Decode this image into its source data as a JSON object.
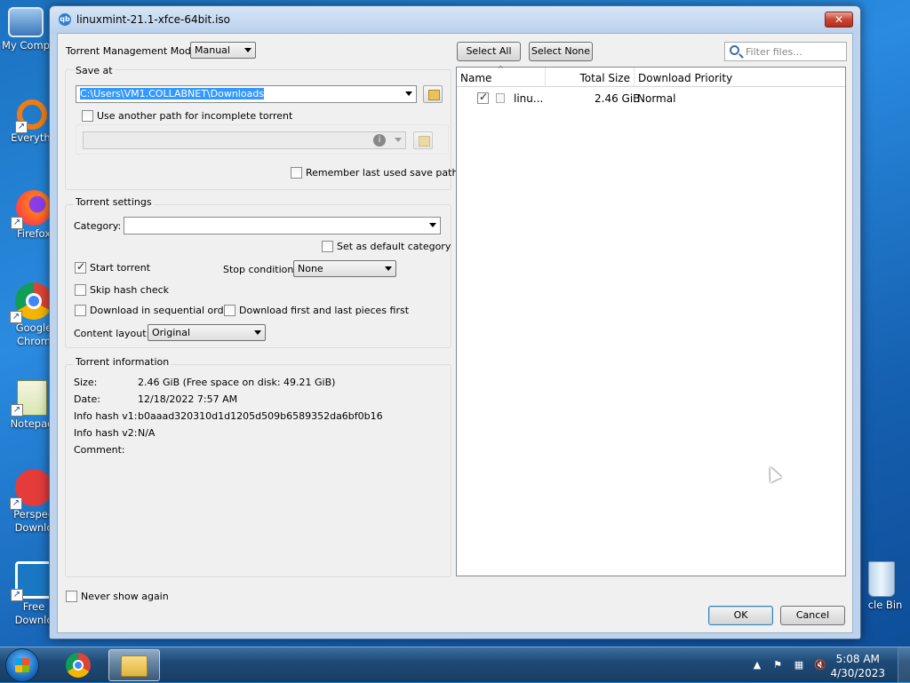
{
  "desktop": {
    "icons": [
      {
        "label": "My Comp",
        "glyph": "🖥"
      },
      {
        "label": "Everythi",
        "glyph": "○"
      },
      {
        "label": "Firefox",
        "glyph": "🦊"
      },
      {
        "label": "Google Chrom",
        "glyph": "◉"
      },
      {
        "label": "Notepad",
        "glyph": "📝"
      },
      {
        "label": "Perspeo Downlo",
        "glyph": "⚡"
      },
      {
        "label": "Free Downlo",
        "glyph": "⇩"
      },
      {
        "label": "cle Bin",
        "glyph": "🗑"
      }
    ]
  },
  "dialog": {
    "title": "linuxmint-21.1-xfce-64bit.iso",
    "close_glyph": "✕",
    "mgmt_mode_label": "Torrent Management Mode:",
    "mgmt_mode_value": "Manual",
    "save_at_title": "Save at",
    "save_path": "C:\\Users\\VM1.COLLABNET\\Downloads",
    "use_another_path_label": "Use another path for incomplete torrent",
    "remember_path_label": "Remember last used save path",
    "torrent_settings_title": "Torrent settings",
    "category_label": "Category:",
    "category_value": "",
    "set_default_category_label": "Set as default category",
    "start_torrent_label": "Start torrent",
    "stop_condition_label": "Stop condition:",
    "stop_condition_value": "None",
    "skip_hash_label": "Skip hash check",
    "sequential_label": "Download in sequential order",
    "first_last_label": "Download first and last pieces first",
    "content_layout_label": "Content layout:",
    "content_layout_value": "Original",
    "torrent_info_title": "Torrent information",
    "info": {
      "size_label": "Size:",
      "size_value": "2.46 GiB (Free space on disk: 49.21 GiB)",
      "date_label": "Date:",
      "date_value": "12/18/2022 7:57 AM",
      "hash_v1_label": "Info hash v1:",
      "hash_v1_value": "b0aaad320310d1d1205d509b6589352da6bf0b16",
      "hash_v2_label": "Info hash v2:",
      "hash_v2_value": "N/A",
      "comment_label": "Comment:"
    },
    "select_all": "Select All",
    "select_none": "Select None",
    "filter_placeholder": "Filter files...",
    "columns": {
      "name": "Name",
      "total_size": "Total Size",
      "priority": "Download Priority"
    },
    "files": [
      {
        "name": "linu...",
        "size": "2.46 GiB",
        "priority": "Normal",
        "checked": true
      }
    ],
    "never_show_label": "Never show again",
    "ok": "OK",
    "cancel": "Cancel",
    "checkboxes": {
      "use_another_path": false,
      "remember_path": false,
      "set_default_category": false,
      "start_torrent": true,
      "skip_hash": false,
      "sequential": false,
      "first_last": false,
      "never_show": false
    }
  },
  "taskbar": {
    "time": "5:08 AM",
    "date": "4/30/2023"
  },
  "colors": {
    "accent": "#3399ff",
    "selection": "#3399ff"
  }
}
